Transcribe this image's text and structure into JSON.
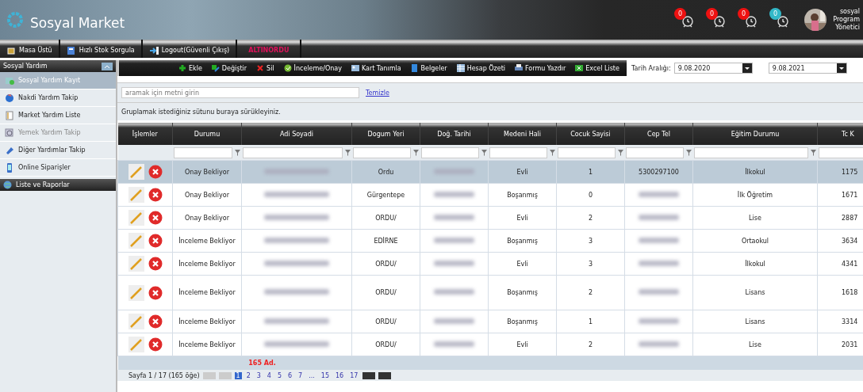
{
  "header": {
    "title": "Sosyal Market",
    "notifications": [
      {
        "count": "0",
        "color": "#ee1111"
      },
      {
        "count": "0",
        "color": "#ee1111"
      },
      {
        "count": "0",
        "color": "#ee1111"
      },
      {
        "count": "0",
        "color": "#33b8c8"
      }
    ],
    "user": {
      "name": "sosyal",
      "role": "Program Yönetici"
    }
  },
  "menu": [
    {
      "label": "Masa Üstü",
      "emphasis": false
    },
    {
      "label": "Hızlı Stok Sorgula",
      "emphasis": false
    },
    {
      "label": "Logout(Güvenli Çıkış)",
      "emphasis": false
    },
    {
      "label": "ALTINORDU",
      "emphasis": true
    }
  ],
  "sidebar": {
    "title": "Sosyal Yardım",
    "items": [
      {
        "label": "Sosyal Yardım Kayıt",
        "selected": true,
        "disabled": false
      },
      {
        "label": "Nakdi Yardım Takip",
        "selected": false,
        "disabled": false
      },
      {
        "label": "Market Yardım Liste",
        "selected": false,
        "disabled": false
      },
      {
        "label": "Yemek Yardım Takip",
        "selected": false,
        "disabled": true
      },
      {
        "label": "Diğer Yardımlar Takip",
        "selected": false,
        "disabled": false
      },
      {
        "label": "Online Siparişler",
        "selected": false,
        "disabled": false
      }
    ],
    "section": "Liste ve Raporlar"
  },
  "toolbar": [
    "Ekle",
    "Değiştir",
    "Sil",
    "İnceleme/Onay",
    "Kart Tanımla",
    "Belgeler",
    "Hesap Özeti",
    "Formu Yazdır",
    "Excel Liste"
  ],
  "date_range": {
    "label": "Tarih Aralığı:",
    "from": "9.08.2020",
    "to": "9.08.2021"
  },
  "search": {
    "placeholder": "aramak için metni girin",
    "clear": "Temizle"
  },
  "group_hint": "Gruplamak istediğiniz sütunu buraya sürükleyiniz.",
  "table": {
    "columns": [
      "İşlemler",
      "Durumu",
      "Adi Soyadi",
      "Dogum Yeri",
      "Doğ. Tarihi",
      "Medeni Hali",
      "Cocuk Sayisi",
      "Cep Tel",
      "Eğitim Durumu",
      "Tc K"
    ],
    "rows": [
      {
        "selected": true,
        "cells": [
          "",
          "Onay Bekliyor",
          null,
          "Ordu",
          null,
          "Evli",
          "1",
          "5300297100",
          "İlkokul",
          "1175"
        ]
      },
      {
        "selected": false,
        "cells": [
          "",
          "Onay Bekliyor",
          null,
          "Gürgentepe",
          null,
          "Boşanmış",
          "0",
          null,
          "İlk Öğretim",
          "1671"
        ]
      },
      {
        "selected": false,
        "cells": [
          "",
          "Onay Bekliyor",
          null,
          "ORDU/",
          null,
          "Evli",
          "2",
          null,
          "Lise",
          "2887"
        ]
      },
      {
        "selected": false,
        "cells": [
          "",
          "İnceleme Bekliyor",
          null,
          "EDİRNE",
          null,
          "Boşanmış",
          "3",
          null,
          "Ortaokul",
          "3634"
        ]
      },
      {
        "selected": false,
        "cells": [
          "",
          "İnceleme Bekliyor",
          null,
          "ORDU/",
          null,
          "Evli",
          "3",
          null,
          "İlkokul",
          "4341"
        ]
      },
      {
        "selected": false,
        "cells": [
          "",
          "İnceleme Bekliyor",
          null,
          "ORDU/",
          null,
          "Boşanmış",
          "2",
          null,
          "Lisans",
          "1618"
        ]
      },
      {
        "selected": false,
        "cells": [
          "",
          "İnceleme Bekliyor",
          null,
          "ORDU/",
          null,
          "Boşanmış",
          "1",
          null,
          "Lisans",
          "3314"
        ]
      },
      {
        "selected": false,
        "cells": [
          "",
          "İnceleme Bekliyor",
          null,
          "ORDU/",
          null,
          "Evli",
          "2",
          null,
          "Lise",
          "2031"
        ]
      }
    ],
    "total": "165 Ad."
  },
  "pager": {
    "summary": "Sayfa 1 / 17 (165 öğe)",
    "pages": [
      {
        "label": "1",
        "selected": true
      },
      {
        "label": "2",
        "selected": false
      },
      {
        "label": "3",
        "selected": false
      },
      {
        "label": "4",
        "selected": false
      },
      {
        "label": "5",
        "selected": false
      },
      {
        "label": "6",
        "selected": false
      },
      {
        "label": "7",
        "selected": false
      },
      {
        "label": "...",
        "selected": false
      },
      {
        "label": "15",
        "selected": false
      },
      {
        "label": "16",
        "selected": false
      },
      {
        "label": "17",
        "selected": false
      }
    ]
  }
}
